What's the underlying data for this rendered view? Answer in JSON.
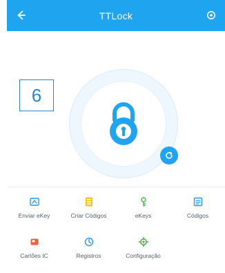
{
  "header": {
    "title": "TTLock",
    "back_icon": "back-arrow-icon",
    "settings_icon": "settings-icon"
  },
  "badge": {
    "text": "6"
  },
  "lock": {
    "icon": "padlock-icon"
  },
  "mini_button": {
    "icon": "refresh-icon"
  },
  "menu": {
    "items": [
      {
        "label": "Enviar eKey",
        "icon": "send-ekey-icon",
        "color": "#2196f3"
      },
      {
        "label": "Criar Códigos",
        "icon": "create-codes-icon",
        "color": "#f0c419"
      },
      {
        "label": "eKeys",
        "icon": "ekeys-icon",
        "color": "#47b44a"
      },
      {
        "label": "Códigos",
        "icon": "codes-icon",
        "color": "#2196f3"
      },
      {
        "label": "Cartões IC",
        "icon": "ic-cards-icon",
        "color": "#f25c3a"
      },
      {
        "label": "Registros",
        "icon": "records-icon",
        "color": "#2196f3"
      },
      {
        "label": "Configuração",
        "icon": "settings-gear-icon",
        "color": "#47b44a"
      }
    ]
  },
  "colors": {
    "accent": "#1fa4f0",
    "badge_border": "#2a84c6"
  }
}
